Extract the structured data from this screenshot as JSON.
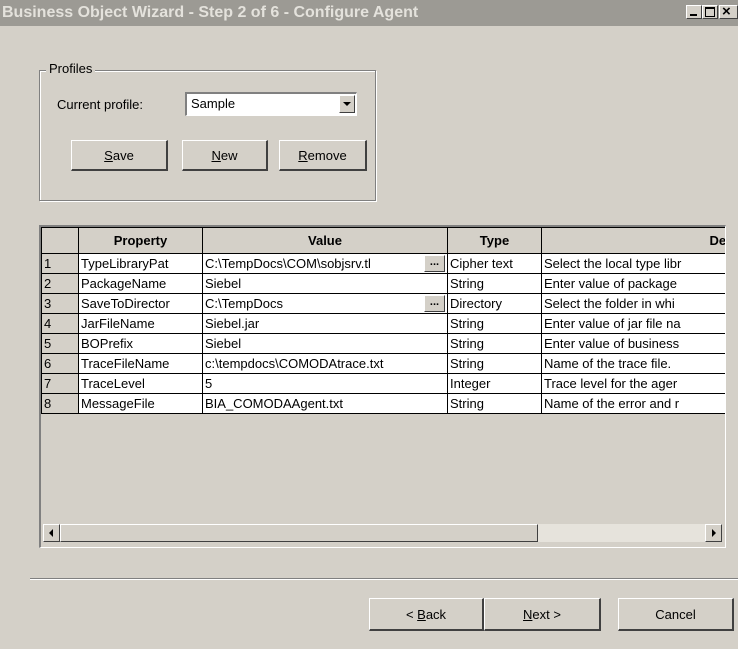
{
  "window": {
    "title": "Business Object Wizard - Step 2 of 6 - Configure Agent"
  },
  "profiles": {
    "group_label": "Profiles",
    "current_label": "Current profile:",
    "current_value": "Sample",
    "buttons": {
      "save_first": "S",
      "save_rest": "ave",
      "new_first": "N",
      "new_rest": "ew",
      "remove_first": "R",
      "remove_rest": "emove"
    }
  },
  "grid": {
    "headers": [
      "",
      "Property",
      "Value",
      "Type",
      "Description"
    ],
    "rows": [
      {
        "num": "1",
        "property": "TypeLibraryPat",
        "value": "C:\\TempDocs\\COM\\sobjsrv.tl",
        "type": "Cipher text",
        "description": "Select the local type libr",
        "has_button": true
      },
      {
        "num": "2",
        "property": "PackageName",
        "value": "Siebel",
        "type": "String",
        "description": "Enter value of package",
        "has_button": false
      },
      {
        "num": "3",
        "property": "SaveToDirector",
        "value": "C:\\TempDocs",
        "type": "Directory",
        "description": "Select the folder in whi",
        "has_button": true
      },
      {
        "num": "4",
        "property": "JarFileName",
        "value": "Siebel.jar",
        "type": "String",
        "description": "Enter value of jar file na",
        "has_button": false
      },
      {
        "num": "5",
        "property": "BOPrefix",
        "value": "Siebel",
        "type": "String",
        "description": "Enter value of business",
        "has_button": false
      },
      {
        "num": "6",
        "property": "TraceFileName",
        "value": "c:\\tempdocs\\COMODAtrace.txt",
        "type": "String",
        "description": "Name of the trace file.",
        "has_button": false
      },
      {
        "num": "7",
        "property": "TraceLevel",
        "value": "5",
        "type": "Integer",
        "description": "Trace level for the ager",
        "has_button": false
      },
      {
        "num": "8",
        "property": "MessageFile",
        "value": "BIA_COMODAAgent.txt",
        "type": "String",
        "description": "Name of the error and r",
        "has_button": false
      }
    ],
    "ellipsis_label": "..."
  },
  "footer": {
    "back_pre": "< ",
    "back_first": "B",
    "back_rest": "ack",
    "next_first": "N",
    "next_rest": "ext >",
    "cancel_label": "Cancel"
  }
}
